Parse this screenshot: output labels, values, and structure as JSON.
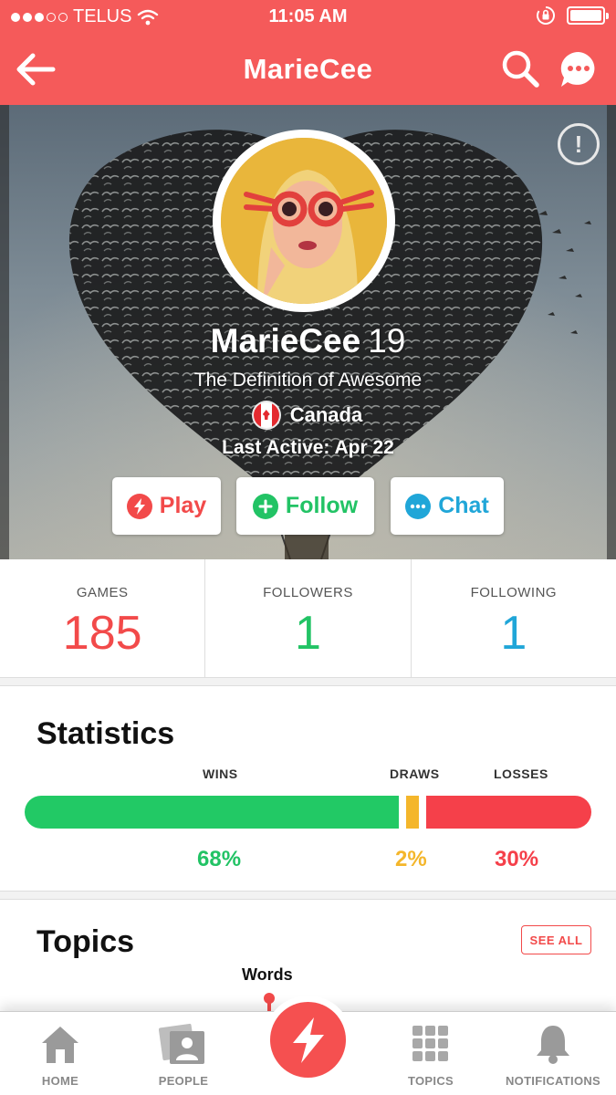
{
  "status_bar": {
    "carrier": "TELUS",
    "time": "11:05 AM"
  },
  "header": {
    "title": "MarieCee"
  },
  "profile": {
    "username": "MarieCee",
    "age": "19",
    "tagline": "The Definition of Awesome",
    "country": "Canada",
    "last_active": "Last Active: Apr 22"
  },
  "actions": {
    "play_label": "Play",
    "follow_label": "Follow",
    "chat_label": "Chat"
  },
  "counts": {
    "games_label": "GAMES",
    "games_value": "185",
    "followers_label": "FOLLOWERS",
    "followers_value": "1",
    "following_label": "FOLLOWING",
    "following_value": "1"
  },
  "statistics": {
    "title": "Statistics",
    "wins_label": "WINS",
    "draws_label": "DRAWS",
    "losses_label": "LOSSES",
    "wins_pct": "68%",
    "draws_pct": "2%",
    "losses_pct": "30%"
  },
  "topics": {
    "title": "Topics",
    "see_all_label": "SEE ALL",
    "first_topic": "Words"
  },
  "tabbar": {
    "home_label": "HOME",
    "people_label": "PEOPLE",
    "topics_label": "TOPICS",
    "notifications_label": "NOTIFICATIONS"
  },
  "colors": {
    "brand_red": "#f55a5a",
    "wins_green": "#22c965",
    "draws_yellow": "#f4b62b",
    "losses_red": "#f5404a",
    "following_blue": "#20a6d8"
  },
  "icons": [
    "back-arrow-icon",
    "search-icon",
    "chat-bubble-icon",
    "report-icon",
    "lightning-icon",
    "plus-icon",
    "home-icon",
    "people-icon",
    "grid-icon",
    "bell-icon"
  ]
}
